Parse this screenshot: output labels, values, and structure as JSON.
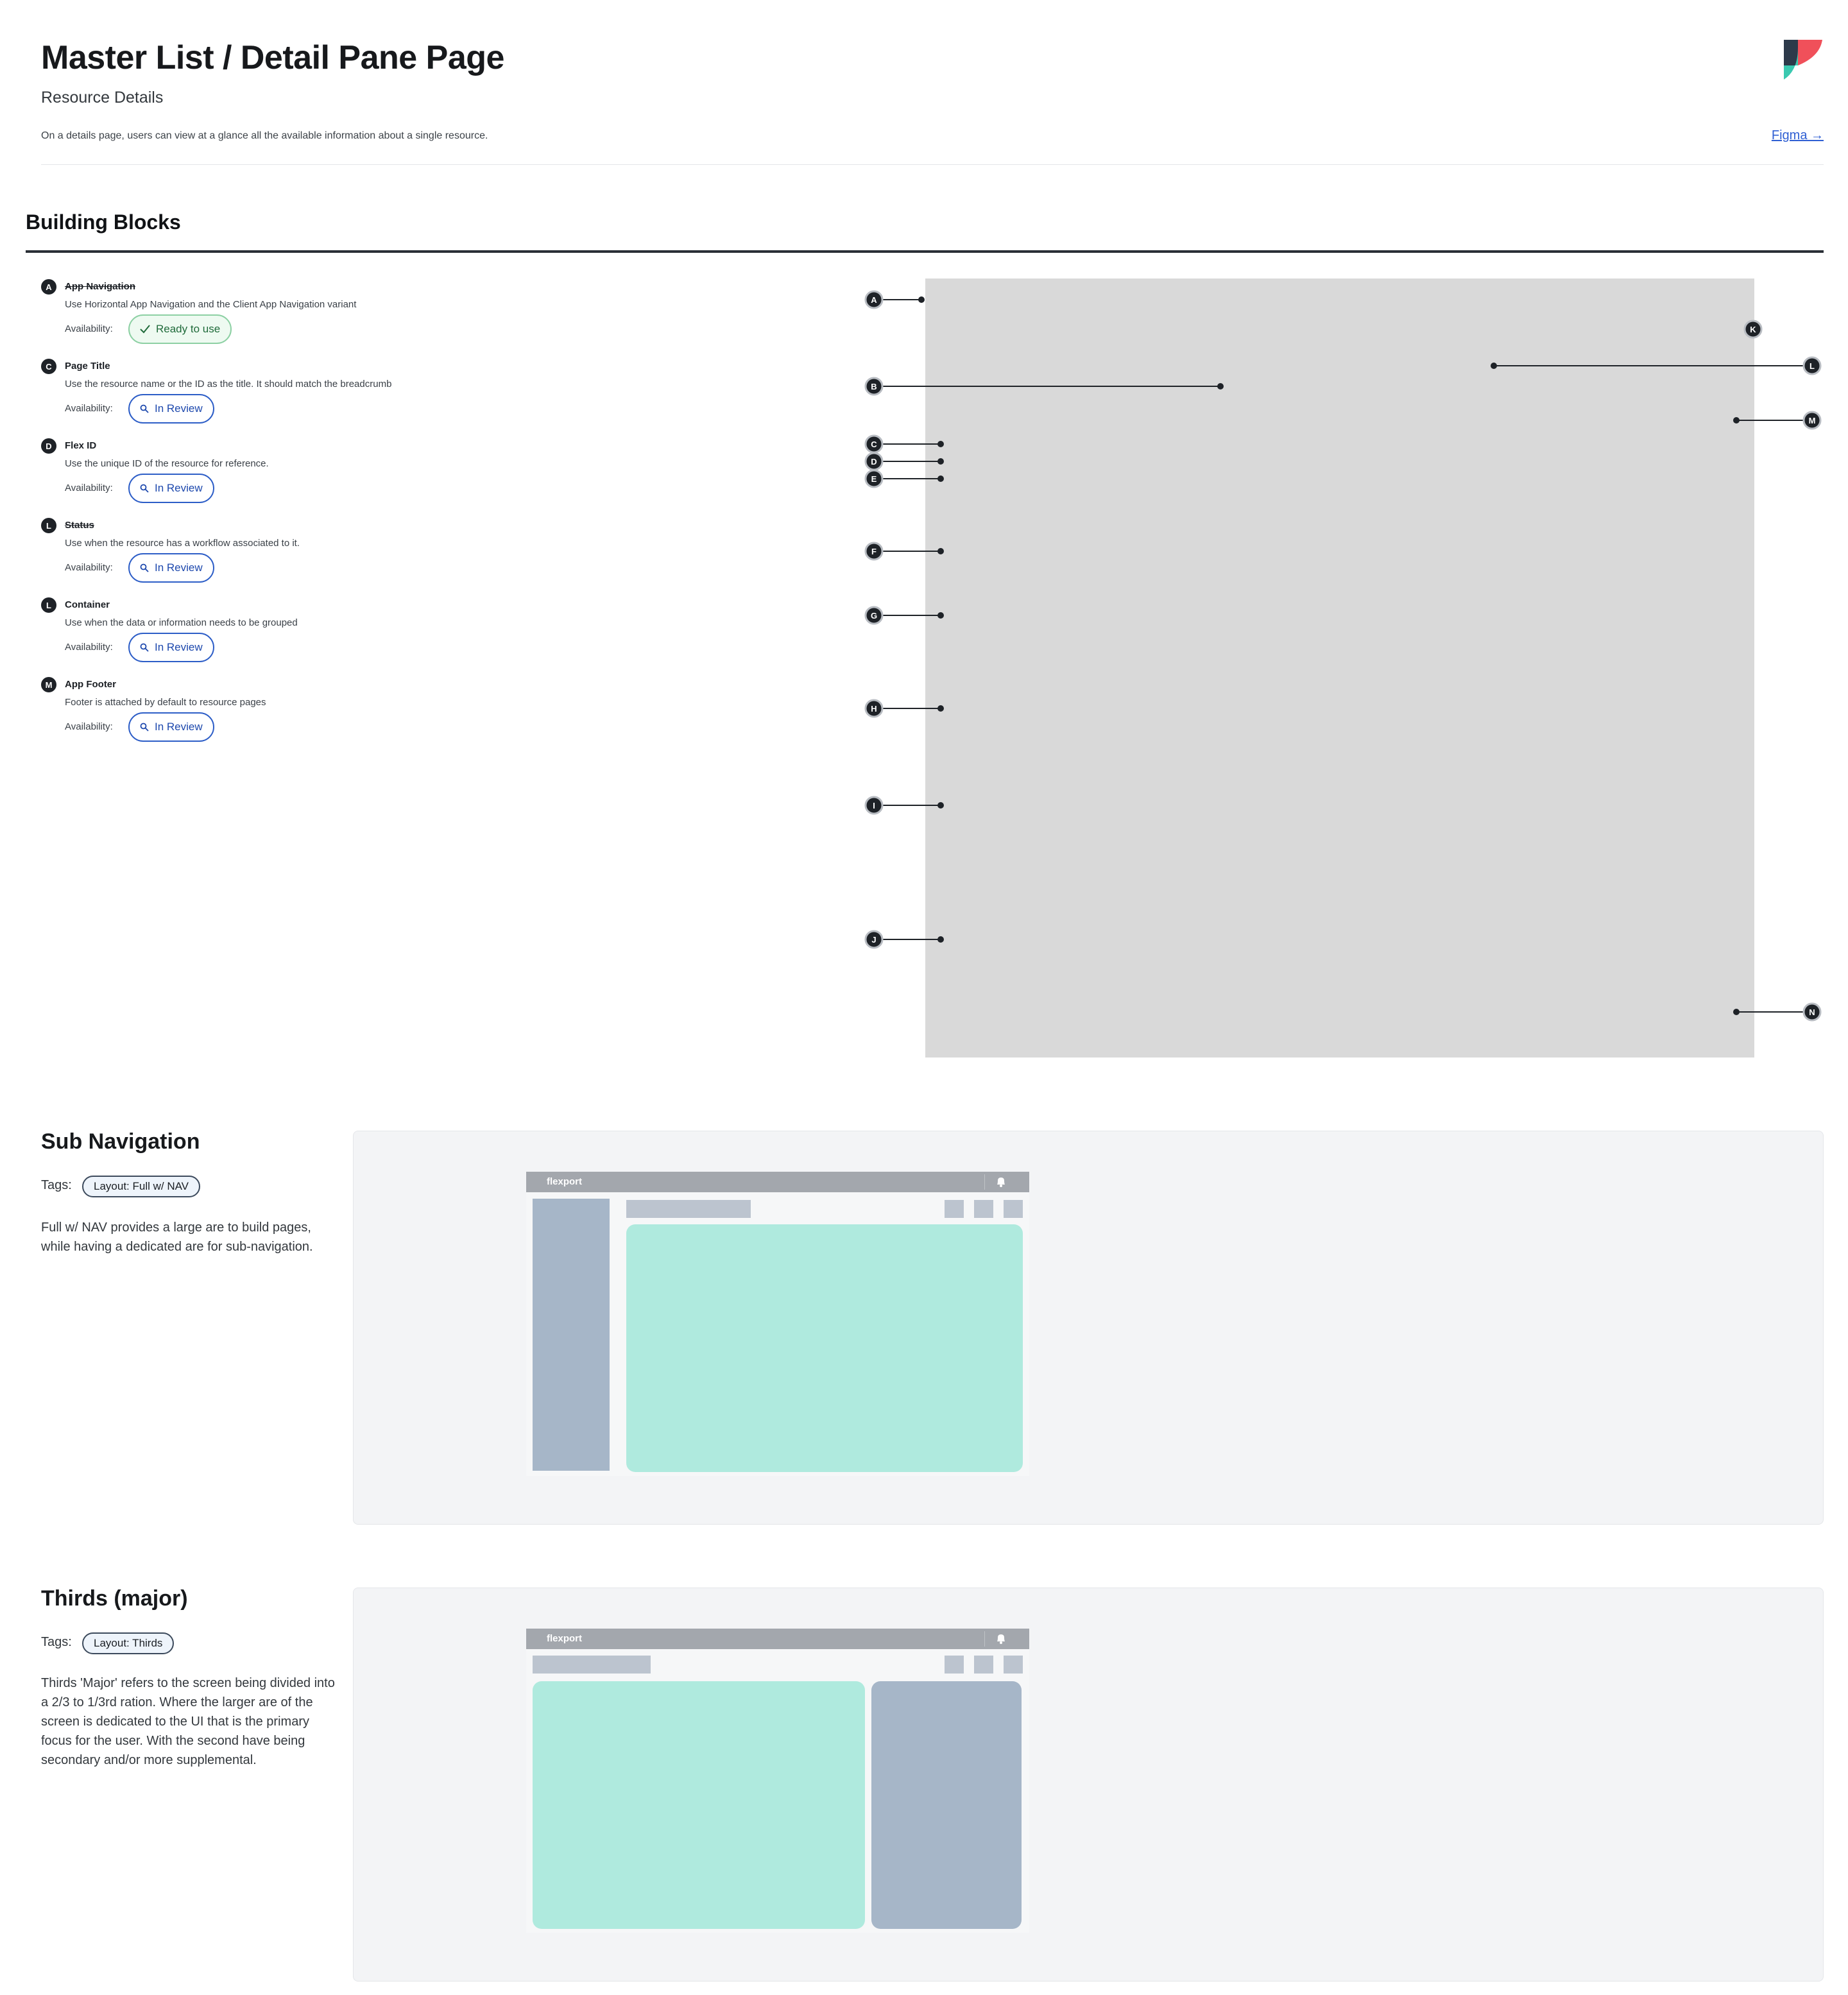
{
  "header": {
    "title": "Master List / Detail Pane Page",
    "subtitle": "Resource Details",
    "description": "On a details page, users can view at a glance all the available information about a single resource.",
    "figma_link": "Figma →"
  },
  "building_blocks": {
    "title": "Building Blocks",
    "availability_label": "Availability:",
    "items": [
      {
        "letter": "A",
        "name": "App Navigation",
        "description": "Use Horizontal App Navigation and the Client App Navigation variant",
        "status": "Ready to use"
      },
      {
        "letter": "C",
        "name": "Page Title",
        "description": "Use the resource name or the ID as the title. It should match the breadcrumb",
        "status": "In Review"
      },
      {
        "letter": "D",
        "name": "Flex ID",
        "description": "Use the unique ID of the resource for reference.",
        "status": "In Review"
      },
      {
        "letter": "L",
        "name": "Status",
        "description": "Use when the resource has a workflow associated to it.",
        "status": "In Review"
      },
      {
        "letter": "L",
        "name": "Container",
        "description": "Use when the data or information needs to be grouped",
        "status": "In Review"
      },
      {
        "letter": "M",
        "name": "App Footer",
        "description": "Footer is attached by default to resource pages",
        "status": "In Review"
      }
    ],
    "markers": [
      "A",
      "B",
      "C",
      "D",
      "E",
      "F",
      "G",
      "H",
      "I",
      "J",
      "K",
      "L",
      "M",
      "N"
    ]
  },
  "sections": [
    {
      "title": "Sub Navigation",
      "tags_label": "Tags:",
      "tag": "Layout: Full w/ NAV",
      "body": "Full w/ NAV provides a large are to build pages, while having a dedicated are for sub-navigation.",
      "mock_brand": "flexport"
    },
    {
      "title": "Thirds (major)",
      "tags_label": "Tags:",
      "tag": "Layout: Thirds",
      "body": "Thirds 'Major' refers to the screen being divided into a 2/3 to 1/3rd ration. Where the larger are of the screen is dedicated to the UI that is the primary focus for the user. With the second have being secondary and/or more supplemental.",
      "mock_brand": "flexport"
    }
  ],
  "colors": {
    "ready_green": "#1f6a3a",
    "review_blue": "#1d48ad",
    "mint_block": "#afeade",
    "nav_block": "#a6b6c8"
  }
}
